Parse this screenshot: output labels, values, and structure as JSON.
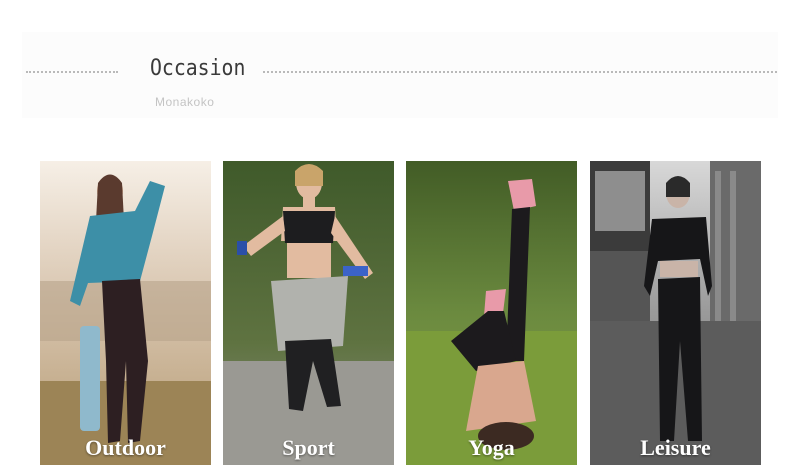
{
  "section": {
    "title": "Occasion",
    "subtitle": "Monakoko"
  },
  "occasions": [
    {
      "label": "Outdoor"
    },
    {
      "label": "Sport"
    },
    {
      "label": "Yoga"
    },
    {
      "label": "Leisure"
    }
  ]
}
